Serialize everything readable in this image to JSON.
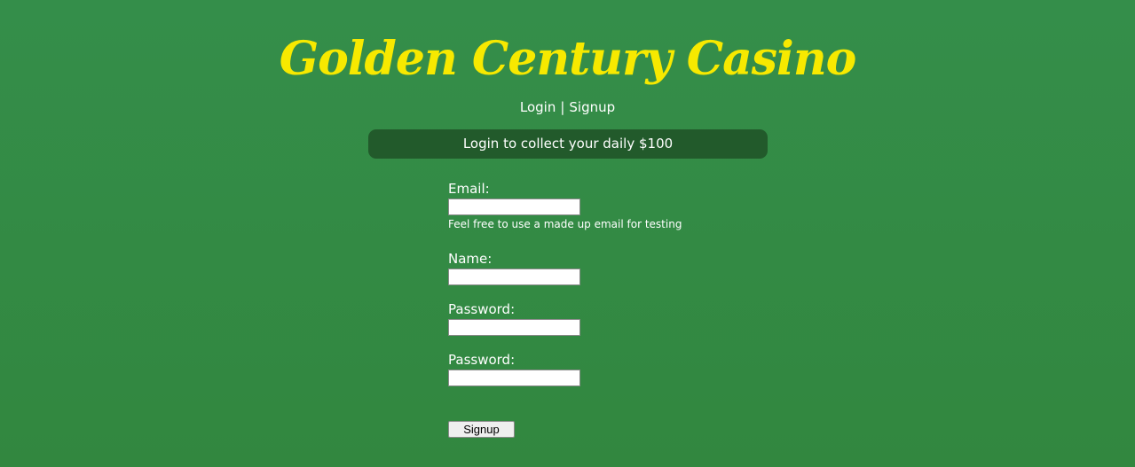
{
  "header": {
    "title": "Golden Century Casino"
  },
  "nav": {
    "login_label": "Login",
    "separator": "|",
    "signup_label": "Signup"
  },
  "banner": {
    "text": "Login to collect your daily $100"
  },
  "form": {
    "email_label": "Email:",
    "email_value": "",
    "email_hint": "Feel free to use a made up email for testing",
    "name_label": "Name:",
    "name_value": "",
    "password_label": "Password:",
    "password_value": "",
    "password_confirm_label": "Password:",
    "password_confirm_value": "",
    "submit_label": "Signup"
  },
  "colors": {
    "background": "#33893f",
    "title": "#f7e900",
    "banner": "#225a2b",
    "text": "#ffffff"
  }
}
